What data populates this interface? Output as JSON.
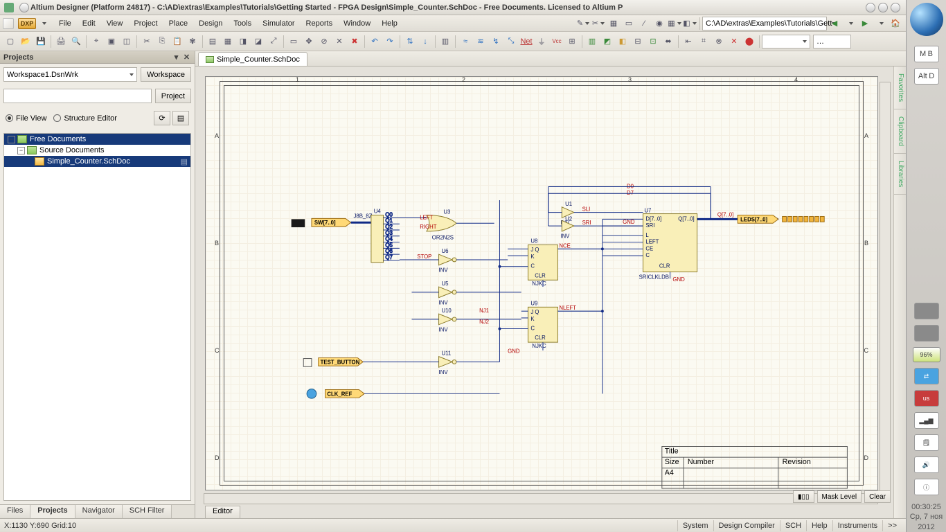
{
  "titlebar": {
    "title": "Altium Designer (Platform 24817) - C:\\AD\\extras\\Examples\\Tutorials\\Getting Started - FPGA Design\\Simple_Counter.SchDoc - Free Documents. Licensed to Altium P"
  },
  "menubar": {
    "dxp": "DXP",
    "items": [
      "File",
      "Edit",
      "View",
      "Project",
      "Place",
      "Design",
      "Tools",
      "Simulator",
      "Reports",
      "Window",
      "Help"
    ]
  },
  "toolbar2": {
    "path": "C:\\AD\\extras\\Examples\\Tutorials\\Gett",
    "vcc": "Vcc"
  },
  "leftpanel": {
    "header": "Projects",
    "workspace_combo": "Workspace1.DsnWrk",
    "workspace_btn": "Workspace",
    "project_combo": "",
    "project_btn": "Project",
    "radio_file": "File View",
    "radio_struct": "Structure Editor",
    "tree": {
      "root": "Free Documents",
      "group": "Source Documents",
      "doc": "Simple_Counter.SchDoc"
    },
    "bottom_tabs": [
      "Files",
      "Projects",
      "Navigator",
      "SCH Filter"
    ]
  },
  "doctab": {
    "label": "Simple_Counter.SchDoc"
  },
  "editor_tab": "Editor",
  "sidebar_tabs": [
    "Favorites",
    "Clipboard",
    "Libraries"
  ],
  "status": {
    "coord": "X:1130 Y:690  Grid:10",
    "right_tabs": [
      "System",
      "Design Compiler",
      "SCH",
      "Help",
      "Instruments",
      ">>"
    ]
  },
  "mask": {
    "level": "Mask Level",
    "clear": "Clear"
  },
  "clock": {
    "time": "00:30:25",
    "date": "Ср, 7 ноя",
    "year": "2012"
  },
  "battery": "96%",
  "dock": {
    "m": "M",
    "b": "B",
    "alt": "Alt",
    "de": "D",
    "lang": "us"
  },
  "titleblock": {
    "fields": {
      "title": "Title",
      "size": "Size",
      "a4": "A4",
      "number": "Number",
      "revision": "Revision"
    }
  },
  "schematic": {
    "ports": {
      "sw": "SW[7..0]",
      "test": "TEST_BUTTON",
      "clk": "CLK_REF",
      "sw_bus": "SW[7..0]",
      "leds": "LEDS[7..0]"
    },
    "designators": {
      "u3": "U3",
      "u4": "U4",
      "u5": "U5",
      "u6": "U6",
      "u8": "U8",
      "u9": "U9",
      "u10": "U10",
      "u11": "U11",
      "u1": "U1",
      "u2": "U2",
      "u7": "U7",
      "bus": "J8B_8Z"
    },
    "nets": {
      "left": "LEFT",
      "right": "RIGHT",
      "stop": "STOP",
      "d0": "D0",
      "d7": "D7",
      "nj1": "NJ1",
      "nj2": "NJ2",
      "nce": "NCE",
      "nleft": "NLEFT",
      "sli": "SLI",
      "sri": "SRI",
      "gnd": "GND",
      "q0": "Q0",
      "q1": "Q1",
      "q2": "Q2",
      "q3": "Q3",
      "q4": "Q4",
      "q5": "Q5",
      "q6": "Q6",
      "q7": "Q7",
      "q70": "Q[7..0]"
    },
    "chip_labels": {
      "jkc": "J   Q",
      "k": "K",
      "c": "C",
      "clr": "CLR",
      "njkc": "NJKC",
      "big": {
        "d": "D[7..0]",
        "sri": "SRI",
        "l": "L",
        "left": "LEFT",
        "ce": "CE",
        "c": "C",
        "clr": "CLR",
        "sliout": "SRICLKLDB",
        "q": "Q[7..0]"
      },
      "or": "OR2N2S",
      "inv": "INV"
    }
  }
}
